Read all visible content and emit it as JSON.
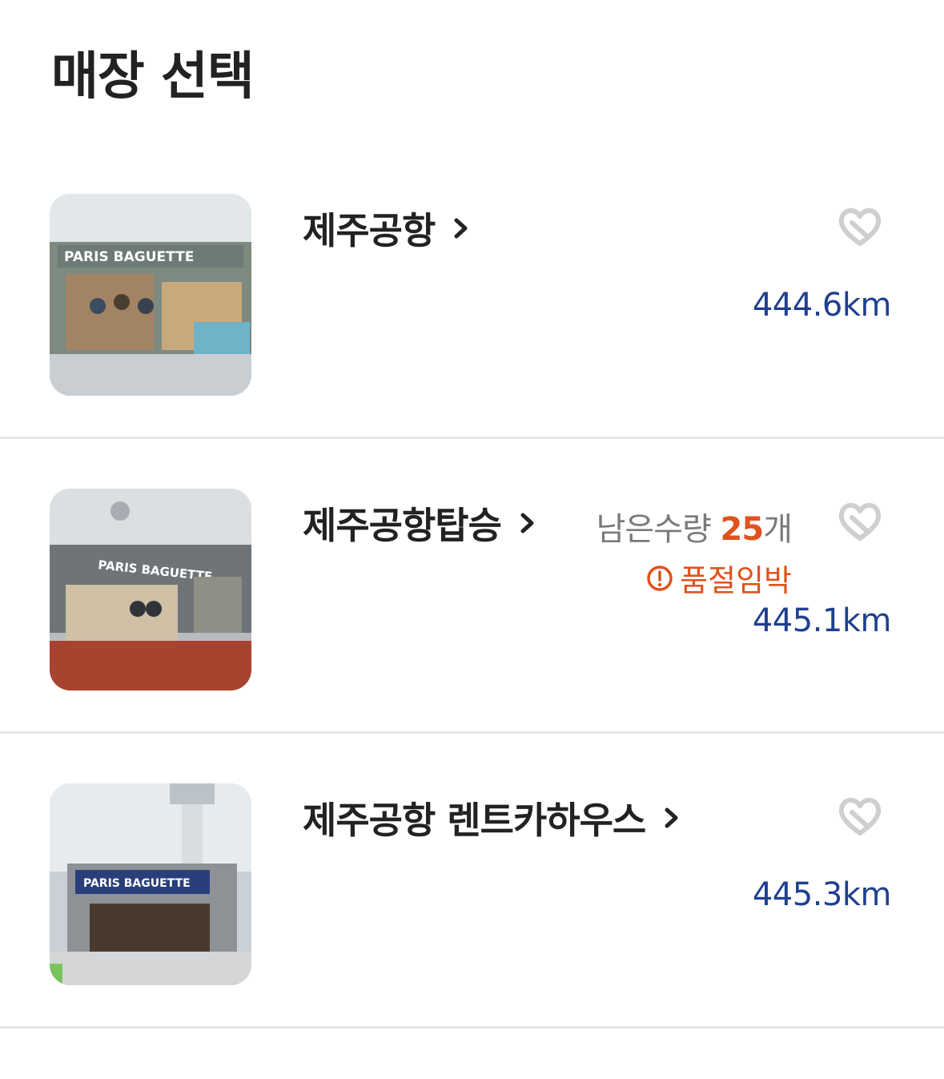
{
  "header": {
    "title": "매장 선택"
  },
  "stores": [
    {
      "name": "제주공항",
      "distance": "444.6km",
      "thumb_label": "PARIS BAGUETTE",
      "thumb_caption": ""
    },
    {
      "name": "제주공항탑승",
      "distance": "445.1km",
      "stock_label": "남은수량",
      "stock_qty": "25",
      "stock_unit": "개",
      "soldout_label": "품절임박",
      "thumb_label": "PARIS BAGUETTE"
    },
    {
      "name": "제주공항 렌트카하우스",
      "distance": "445.3km",
      "thumb_label": "PARIS BAGUETTE"
    }
  ],
  "colors": {
    "distance": "#1f3f8f",
    "accent": "#e0521c",
    "divider": "#e6e6e6"
  },
  "icons": {
    "chevron": "chevron-right-icon",
    "favorite": "heart-outline-icon",
    "alert": "alert-circle-icon"
  }
}
